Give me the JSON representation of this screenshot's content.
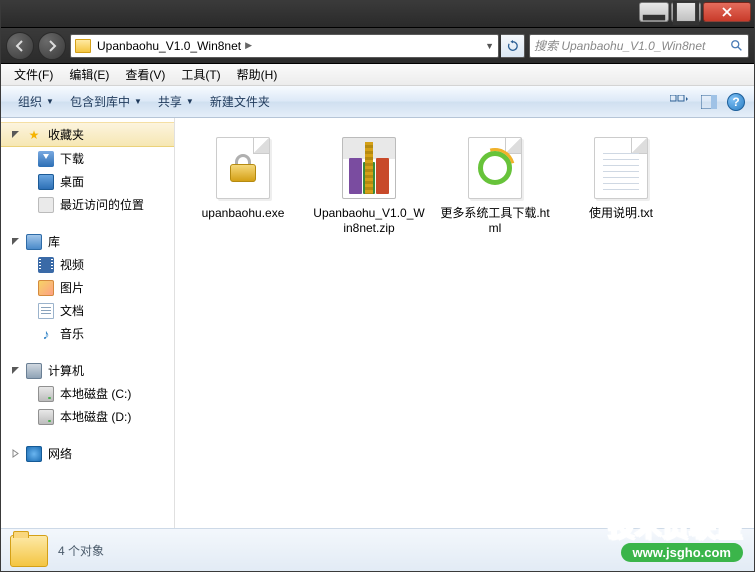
{
  "window": {
    "min": "–",
    "max": "☐",
    "close": "✕"
  },
  "address": {
    "crumb1": "Upanbaohu_V1.0_Win8net"
  },
  "search": {
    "placeholder": "搜索 Upanbaohu_V1.0_Win8net"
  },
  "menubar": {
    "file": "文件(F)",
    "edit": "编辑(E)",
    "view": "查看(V)",
    "tools": "工具(T)",
    "help": "帮助(H)"
  },
  "toolbar": {
    "organize": "组织",
    "include": "包含到库中",
    "share": "共享",
    "newfolder": "新建文件夹"
  },
  "sidebar": {
    "favorites": {
      "label": "收藏夹",
      "items": [
        "下载",
        "桌面",
        "最近访问的位置"
      ]
    },
    "libraries": {
      "label": "库",
      "items": [
        "视频",
        "图片",
        "文档",
        "音乐"
      ]
    },
    "computer": {
      "label": "计算机",
      "items": [
        "本地磁盘 (C:)",
        "本地磁盘 (D:)"
      ]
    },
    "network": {
      "label": "网络"
    }
  },
  "files": [
    {
      "name": "upanbaohu.exe"
    },
    {
      "name": "Upanbaohu_V1.0_Win8net.zip"
    },
    {
      "name": "更多系统工具下载.html"
    },
    {
      "name": "使用说明.txt"
    }
  ],
  "status": {
    "count": "4 个对象"
  },
  "watermark": {
    "title": "技术员联盟",
    "url": "www.jsgho.com"
  }
}
